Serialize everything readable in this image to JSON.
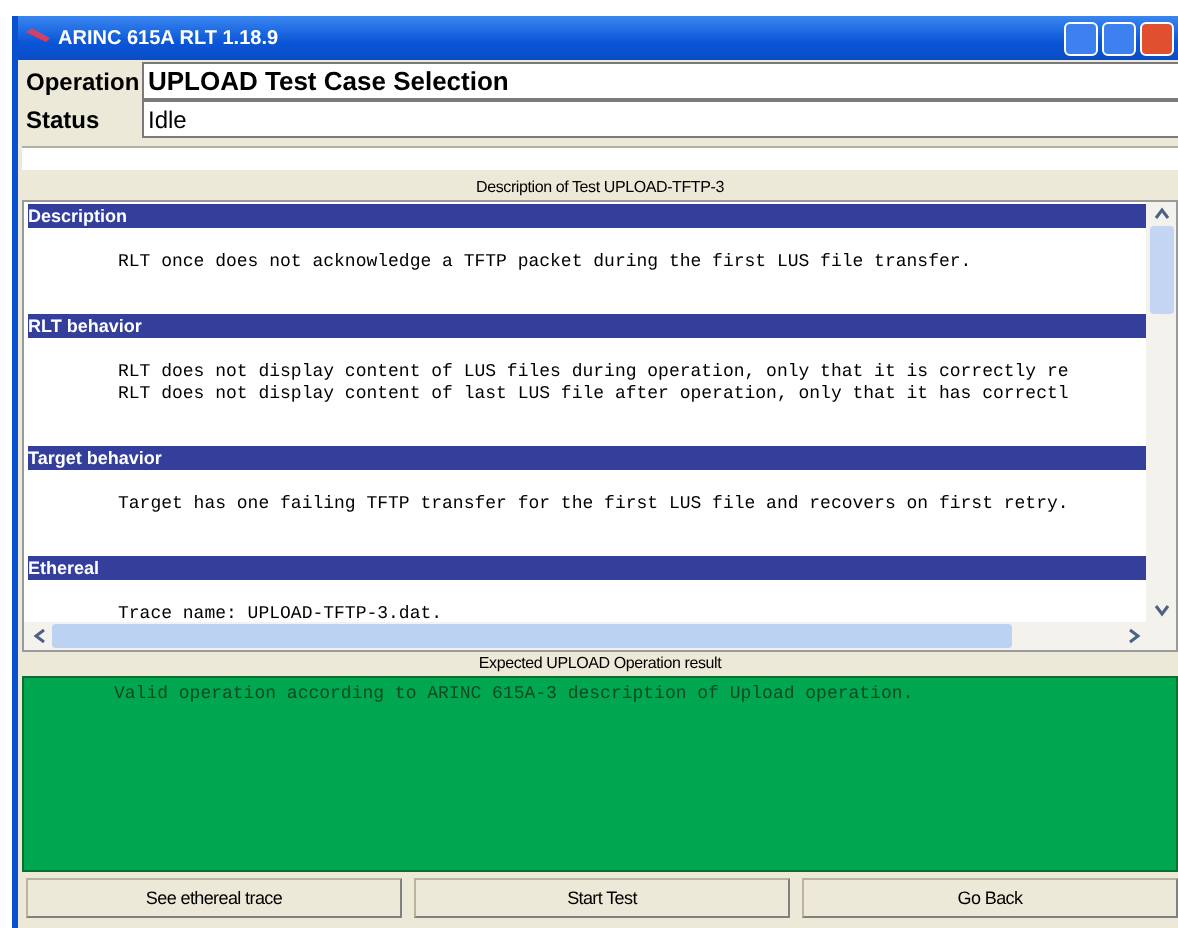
{
  "window": {
    "title": "ARINC 615A RLT 1.18.9"
  },
  "fields": [
    {
      "label": "Operation",
      "value": "UPLOAD Test Case Selection",
      "kind": "bold"
    },
    {
      "label": "Status",
      "value": "Idle",
      "kind": "plain"
    }
  ],
  "description_panel": {
    "title": "Description of Test UPLOAD-TFTP-3",
    "sections": [
      {
        "heading": "Description",
        "lines": [
          "RLT once does not acknowledge a TFTP packet during the first LUS file transfer."
        ]
      },
      {
        "heading": "RLT behavior",
        "lines": [
          "RLT does not display content of LUS files during operation, only that it is correctly re",
          "RLT does not display content of last LUS file after operation, only that it has correctl"
        ]
      },
      {
        "heading": "Target behavior",
        "lines": [
          "Target has one failing TFTP transfer for the first LUS file and recovers on first retry."
        ]
      },
      {
        "heading": "Ethereal",
        "lines": [
          "Trace name: UPLOAD-TFTP-3.dat."
        ]
      }
    ]
  },
  "result_panel": {
    "title": "Expected UPLOAD Operation result",
    "text": "Valid operation according to ARINC 615A-3 description of Upload operation."
  },
  "buttons": [
    "See ethereal trace",
    "Start Test",
    "Go Back"
  ]
}
